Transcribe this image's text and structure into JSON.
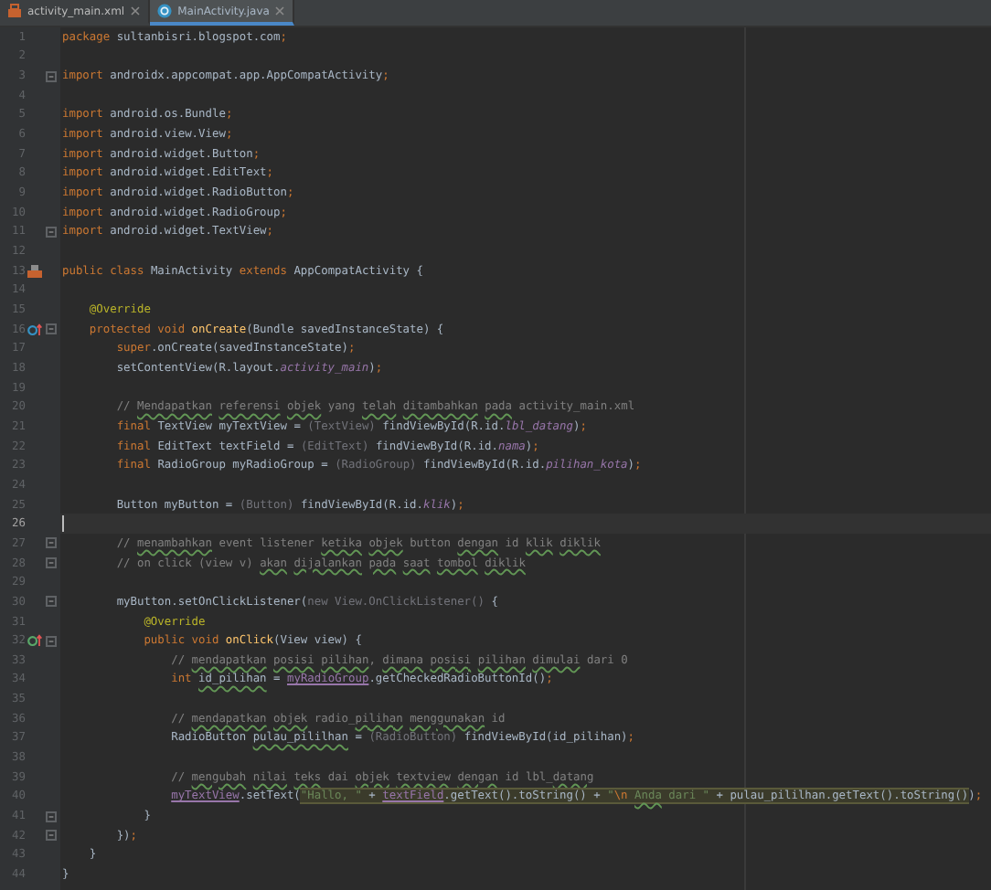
{
  "tabs": [
    {
      "label": "activity_main.xml",
      "kind": "xml",
      "selected": false
    },
    {
      "label": "MainActivity.java",
      "kind": "java",
      "selected": true
    }
  ],
  "lines": [
    {
      "number": "1",
      "kind": "code",
      "current": false,
      "fold": false,
      "segments": [
        {
          "kind": "kw",
          "text": "package"
        },
        {
          "kind": "plain",
          "text": " sultanbisri.blogspot.com"
        },
        {
          "kind": "punct",
          "text": ";"
        }
      ]
    },
    {
      "number": "2",
      "kind": "code",
      "current": false,
      "fold": false
    },
    {
      "number": "3",
      "kind": "code",
      "current": false,
      "fold": true,
      "segments": [
        {
          "kind": "kw",
          "text": "import"
        },
        {
          "kind": "plain",
          "text": " androidx.appcompat.app.AppCompatActivity"
        },
        {
          "kind": "punct",
          "text": ";"
        }
      ]
    },
    {
      "number": "4",
      "kind": "code",
      "current": false,
      "fold": false
    },
    {
      "number": "5",
      "kind": "code",
      "current": false,
      "fold": false,
      "segments": [
        {
          "kind": "kw",
          "text": "import"
        },
        {
          "kind": "plain",
          "text": " android.os.Bundle"
        },
        {
          "kind": "punct",
          "text": ";"
        }
      ]
    },
    {
      "number": "6",
      "kind": "code",
      "current": false,
      "fold": false,
      "segments": [
        {
          "kind": "kw",
          "text": "import"
        },
        {
          "kind": "plain",
          "text": " android.view.View"
        },
        {
          "kind": "punct",
          "text": ";"
        }
      ]
    },
    {
      "number": "7",
      "kind": "code",
      "current": false,
      "fold": false,
      "segments": [
        {
          "kind": "kw",
          "text": "import"
        },
        {
          "kind": "plain",
          "text": " android.widget.Button"
        },
        {
          "kind": "punct",
          "text": ";"
        }
      ]
    },
    {
      "number": "8",
      "kind": "code",
      "current": false,
      "fold": false,
      "segments": [
        {
          "kind": "kw",
          "text": "import"
        },
        {
          "kind": "plain",
          "text": " android.widget.EditText"
        },
        {
          "kind": "punct",
          "text": ";"
        }
      ]
    },
    {
      "number": "9",
      "kind": "code",
      "current": false,
      "fold": false,
      "segments": [
        {
          "kind": "kw",
          "text": "import"
        },
        {
          "kind": "plain",
          "text": " android.widget.RadioButton"
        },
        {
          "kind": "punct",
          "text": ";"
        }
      ]
    },
    {
      "number": "10",
      "kind": "code",
      "current": false,
      "fold": false,
      "segments": [
        {
          "kind": "kw",
          "text": "import"
        },
        {
          "kind": "plain",
          "text": " android.widget.RadioGroup"
        },
        {
          "kind": "punct",
          "text": ";"
        }
      ]
    },
    {
      "number": "11",
      "kind": "code",
      "current": false,
      "fold": true,
      "segments": [
        {
          "kind": "kw",
          "text": "import"
        },
        {
          "kind": "plain",
          "text": " android.widget.TextView"
        },
        {
          "kind": "punct",
          "text": ";"
        }
      ]
    },
    {
      "number": "12",
      "kind": "code",
      "current": false,
      "fold": false
    },
    {
      "number": "13",
      "kind": "class",
      "current": false,
      "fold": false,
      "segments": [
        {
          "kind": "kw",
          "text": "public class"
        },
        {
          "kind": "plain",
          "text": " MainActivity "
        },
        {
          "kind": "kw",
          "text": "extends"
        },
        {
          "kind": "plain",
          "text": " AppCompatActivity {"
        }
      ]
    },
    {
      "number": "14",
      "kind": "code",
      "current": false,
      "fold": false
    },
    {
      "number": "15",
      "kind": "code",
      "current": false,
      "fold": false,
      "segments": [
        {
          "kind": "annot",
          "text": "    @Override"
        }
      ]
    },
    {
      "number": "16",
      "kind": "overrides",
      "current": false,
      "fold": true,
      "segments": [
        {
          "kind": "kw",
          "text": "    protected void "
        },
        {
          "kind": "decl",
          "text": "onCreate"
        },
        {
          "kind": "plain",
          "text": "(Bundle savedInstanceState) {"
        }
      ]
    },
    {
      "number": "17",
      "kind": "code",
      "current": false,
      "fold": false,
      "segments": [
        {
          "kind": "kw",
          "text": "        super"
        },
        {
          "kind": "plain",
          "text": ".onCreate(savedInstanceState)"
        },
        {
          "kind": "punct",
          "text": ";"
        }
      ]
    },
    {
      "number": "18",
      "kind": "code",
      "current": false,
      "fold": false,
      "segments": [
        {
          "kind": "plain",
          "text": "        setContentView(R.layout."
        },
        {
          "kind": "field",
          "text": "activity_main"
        },
        {
          "kind": "plain",
          "text": ")"
        },
        {
          "kind": "punct",
          "text": ";"
        }
      ]
    },
    {
      "number": "19",
      "kind": "code",
      "current": false,
      "fold": false
    },
    {
      "number": "20",
      "kind": "code",
      "current": false,
      "fold": false,
      "segments": [
        {
          "kind": "comment",
          "text": "        // "
        },
        {
          "kind": "typo",
          "text": "Mendapatkan "
        },
        {
          "kind": "typo",
          "text": "referensi "
        },
        {
          "kind": "typo",
          "text": "objek"
        },
        {
          "kind": "comment",
          "text": " yang "
        },
        {
          "kind": "typo",
          "text": "telah "
        },
        {
          "kind": "typo",
          "text": "ditambahkan "
        },
        {
          "kind": "typo",
          "text": "pada"
        },
        {
          "kind": "comment",
          "text": " activity_main.xml"
        }
      ]
    },
    {
      "number": "21",
      "kind": "code",
      "current": false,
      "fold": false,
      "segments": [
        {
          "kind": "kw",
          "text": "        final"
        },
        {
          "kind": "plain",
          "text": " TextView myTextView = "
        },
        {
          "kind": "cast",
          "text": "(TextView)"
        },
        {
          "kind": "plain",
          "text": " findViewById(R.id."
        },
        {
          "kind": "field",
          "text": "lbl_datang"
        },
        {
          "kind": "plain",
          "text": ")"
        },
        {
          "kind": "punct",
          "text": ";"
        }
      ]
    },
    {
      "number": "22",
      "kind": "code",
      "current": false,
      "fold": false,
      "segments": [
        {
          "kind": "kw",
          "text": "        final"
        },
        {
          "kind": "plain",
          "text": " EditText textField = "
        },
        {
          "kind": "cast",
          "text": "(EditText)"
        },
        {
          "kind": "plain",
          "text": " findViewById(R.id."
        },
        {
          "kind": "field",
          "text": "nama"
        },
        {
          "kind": "plain",
          "text": ")"
        },
        {
          "kind": "punct",
          "text": ";"
        }
      ]
    },
    {
      "number": "23",
      "kind": "code",
      "current": false,
      "fold": false,
      "segments": [
        {
          "kind": "kw",
          "text": "        final"
        },
        {
          "kind": "plain",
          "text": " RadioGroup myRadioGroup = "
        },
        {
          "kind": "cast",
          "text": "(RadioGroup)"
        },
        {
          "kind": "plain",
          "text": " findViewById(R.id."
        },
        {
          "kind": "field",
          "text": "pilihan_kota"
        },
        {
          "kind": "plain",
          "text": ")"
        },
        {
          "kind": "punct",
          "text": ";"
        }
      ]
    },
    {
      "number": "24",
      "kind": "code",
      "current": false,
      "fold": false
    },
    {
      "number": "25",
      "kind": "code",
      "current": false,
      "fold": false,
      "segments": [
        {
          "kind": "plain",
          "text": "        Button myButton = "
        },
        {
          "kind": "cast",
          "text": "(Button)"
        },
        {
          "kind": "plain",
          "text": " findViewById(R.id."
        },
        {
          "kind": "field",
          "text": "klik"
        },
        {
          "kind": "plain",
          "text": ")"
        },
        {
          "kind": "punct",
          "text": ";"
        }
      ]
    },
    {
      "number": "26",
      "kind": "code",
      "current": true,
      "fold": false
    },
    {
      "number": "27",
      "kind": "code",
      "current": false,
      "fold": true,
      "segments": [
        {
          "kind": "comment",
          "text": "        // "
        },
        {
          "kind": "typo",
          "text": "menambahkan"
        },
        {
          "kind": "comment",
          "text": " event listener "
        },
        {
          "kind": "typo",
          "text": "ketika "
        },
        {
          "kind": "typo",
          "text": "objek"
        },
        {
          "kind": "comment",
          "text": " button "
        },
        {
          "kind": "typo",
          "text": "dengan"
        },
        {
          "kind": "comment",
          "text": " id "
        },
        {
          "kind": "typo",
          "text": "klik "
        },
        {
          "kind": "typo",
          "text": "diklik"
        }
      ]
    },
    {
      "number": "28",
      "kind": "code",
      "current": false,
      "fold": true,
      "segments": [
        {
          "kind": "comment",
          "text": "        // on click (view v) "
        },
        {
          "kind": "typo",
          "text": "akan "
        },
        {
          "kind": "typo",
          "text": "dijalankan "
        },
        {
          "kind": "typo",
          "text": "pada "
        },
        {
          "kind": "typo",
          "text": "saat "
        },
        {
          "kind": "typo",
          "text": "tombol "
        },
        {
          "kind": "typo",
          "text": "diklik"
        }
      ]
    },
    {
      "number": "29",
      "kind": "code",
      "current": false,
      "fold": false
    },
    {
      "number": "30",
      "kind": "code",
      "current": false,
      "fold": true,
      "segments": [
        {
          "kind": "plain",
          "text": "        myButton.setOnClickListener("
        },
        {
          "kind": "cast",
          "text": "new View.OnClickListener()"
        },
        {
          "kind": "plain",
          "text": " {"
        }
      ]
    },
    {
      "number": "31",
      "kind": "code",
      "current": false,
      "fold": false,
      "segments": [
        {
          "kind": "annot",
          "text": "            @Override"
        }
      ]
    },
    {
      "number": "32",
      "kind": "implements",
      "current": false,
      "fold": true,
      "segments": [
        {
          "kind": "kw",
          "text": "            public void "
        },
        {
          "kind": "decl",
          "text": "onClick"
        },
        {
          "kind": "plain",
          "text": "(View view) {"
        }
      ]
    },
    {
      "number": "33",
      "kind": "code",
      "current": false,
      "fold": false,
      "segments": [
        {
          "kind": "comment",
          "text": "                // "
        },
        {
          "kind": "typo",
          "text": "mendapatkan "
        },
        {
          "kind": "typo",
          "text": "posisi "
        },
        {
          "kind": "typo",
          "text": "pilihan"
        },
        {
          "kind": "comment",
          "text": ", "
        },
        {
          "kind": "typo",
          "text": "dimana "
        },
        {
          "kind": "typo",
          "text": "posisi "
        },
        {
          "kind": "typo",
          "text": "pilihan "
        },
        {
          "kind": "typo",
          "text": "dimulai"
        },
        {
          "kind": "comment",
          "text": " dari 0"
        }
      ]
    },
    {
      "number": "34",
      "kind": "code",
      "current": false,
      "fold": false,
      "segments": [
        {
          "kind": "kw",
          "text": "                int "
        },
        {
          "kind": "identtypo",
          "text": "id_pilihan"
        },
        {
          "kind": "plain",
          "text": " = "
        },
        {
          "kind": "member",
          "text": "myRadioGroup"
        },
        {
          "kind": "plain",
          "text": ".getCheckedRadioButtonId()"
        },
        {
          "kind": "punct",
          "text": ";"
        }
      ]
    },
    {
      "number": "35",
      "kind": "code",
      "current": false,
      "fold": false
    },
    {
      "number": "36",
      "kind": "code",
      "current": false,
      "fold": false,
      "segments": [
        {
          "kind": "comment",
          "text": "                // "
        },
        {
          "kind": "typo",
          "text": "mendapatkan "
        },
        {
          "kind": "typo",
          "text": "objek"
        },
        {
          "kind": "comment",
          "text": " radio_"
        },
        {
          "kind": "typo",
          "text": "pilihan "
        },
        {
          "kind": "typo",
          "text": "menggunakan"
        },
        {
          "kind": "comment",
          "text": " id"
        }
      ]
    },
    {
      "number": "37",
      "kind": "code",
      "current": false,
      "fold": false,
      "segments": [
        {
          "kind": "plain",
          "text": "                RadioButton "
        },
        {
          "kind": "identtypo",
          "text": "pulau_pililhan"
        },
        {
          "kind": "plain",
          "text": " = "
        },
        {
          "kind": "cast",
          "text": "(RadioButton)"
        },
        {
          "kind": "plain",
          "text": " findViewById(id_pilihan)"
        },
        {
          "kind": "punct",
          "text": ";"
        }
      ]
    },
    {
      "number": "38",
      "kind": "code",
      "current": false,
      "fold": false
    },
    {
      "number": "39",
      "kind": "code",
      "current": false,
      "fold": false,
      "segments": [
        {
          "kind": "comment",
          "text": "                // "
        },
        {
          "kind": "typo",
          "text": "mengubah "
        },
        {
          "kind": "typo",
          "text": "nilai "
        },
        {
          "kind": "typo",
          "text": "teks"
        },
        {
          "kind": "comment",
          "text": " dai "
        },
        {
          "kind": "typo",
          "text": "objek "
        },
        {
          "kind": "typo",
          "text": "textview "
        },
        {
          "kind": "typo",
          "text": "dengan"
        },
        {
          "kind": "comment",
          "text": " id lbl_"
        },
        {
          "kind": "typo",
          "text": "datang"
        }
      ]
    },
    {
      "number": "40",
      "kind": "code",
      "current": false,
      "fold": false,
      "segments": [
        {
          "kind": "member",
          "text": "                myTextView",
          "highlighted": false
        },
        {
          "kind": "plain",
          "text": ".setText(",
          "highlighted": false
        },
        {
          "kind": "str",
          "text": "\"Hallo, \"",
          "highlighted": true
        },
        {
          "kind": "plain",
          "text": " + ",
          "highlighted": true
        },
        {
          "kind": "member",
          "text": "textField",
          "highlighted": true
        },
        {
          "kind": "plain",
          "text": ".getText().toString() + ",
          "highlighted": true
        },
        {
          "kind": "str",
          "text": "\"",
          "highlighted": true
        },
        {
          "kind": "esc",
          "text": "\\n ",
          "highlighted": true
        },
        {
          "kind": "strtypo",
          "text": "Anda",
          "highlighted": true
        },
        {
          "kind": "str",
          "text": " dari \"",
          "highlighted": true
        },
        {
          "kind": "plain",
          "text": " + pulau_pililhan.getText().toString()",
          "highlighted": true
        },
        {
          "kind": "plain",
          "text": ")",
          "highlighted": false
        },
        {
          "kind": "punct",
          "text": ";",
          "highlighted": false
        }
      ]
    },
    {
      "number": "41",
      "kind": "code",
      "current": false,
      "fold": true,
      "segments": [
        {
          "kind": "plain",
          "text": "            }"
        }
      ]
    },
    {
      "number": "42",
      "kind": "code",
      "current": false,
      "fold": true,
      "segments": [
        {
          "kind": "plain",
          "text": "        })"
        },
        {
          "kind": "punct",
          "text": ";"
        }
      ]
    },
    {
      "number": "43",
      "kind": "code",
      "current": false,
      "fold": false,
      "segments": [
        {
          "kind": "plain",
          "text": "    }"
        }
      ]
    },
    {
      "number": "44",
      "kind": "code",
      "current": false,
      "fold": false,
      "segments": [
        {
          "kind": "plain",
          "text": "}"
        }
      ]
    }
  ]
}
